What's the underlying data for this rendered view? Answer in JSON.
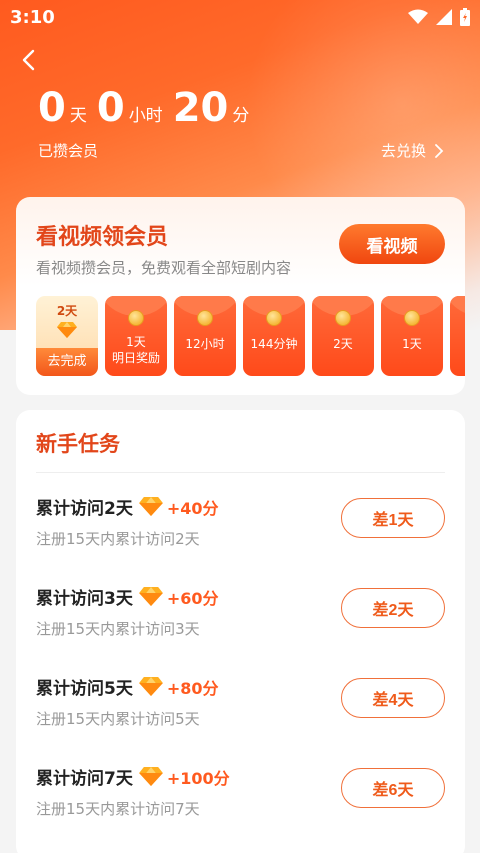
{
  "status_bar": {
    "time": "3:10"
  },
  "balance": {
    "days": "0",
    "days_unit": "天",
    "hours": "0",
    "hours_unit": "小时",
    "minutes": "20",
    "minutes_unit": "分",
    "label": "已攒会员",
    "redeem_label": "去兑换"
  },
  "video_card": {
    "title": "看视频领会员",
    "subtitle": "看视频攒会员，免费观看全部短剧内容",
    "button_label": "看视频",
    "rewards": [
      {
        "day": "2天",
        "action": "去完成"
      },
      {
        "label": "1天\n明日奖励"
      },
      {
        "label": "12小时"
      },
      {
        "label": "144分钟"
      },
      {
        "label": "2天"
      },
      {
        "label": "1天"
      }
    ]
  },
  "tasks": {
    "title": "新手任务",
    "items": [
      {
        "name": "累计访问2天",
        "points": "+40分",
        "desc": "注册15天内累计访问2天",
        "button": "差1天"
      },
      {
        "name": "累计访问3天",
        "points": "+60分",
        "desc": "注册15天内累计访问3天",
        "button": "差2天"
      },
      {
        "name": "累计访问5天",
        "points": "+80分",
        "desc": "注册15天内累计访问5天",
        "button": "差4天"
      },
      {
        "name": "累计访问7天",
        "points": "+100分",
        "desc": "注册15天内累计访问7天",
        "button": "差6天"
      }
    ]
  },
  "icons": {
    "back": "chevron-left-icon",
    "redeem_arrow": "chevron-right-icon",
    "points": "diamond-icon",
    "status": [
      "wifi-icon",
      "signal-icon",
      "battery-icon"
    ]
  },
  "colors": {
    "accent": "#ff5a1f",
    "title_red": "#e2461a",
    "gold": "#f6b93a"
  }
}
